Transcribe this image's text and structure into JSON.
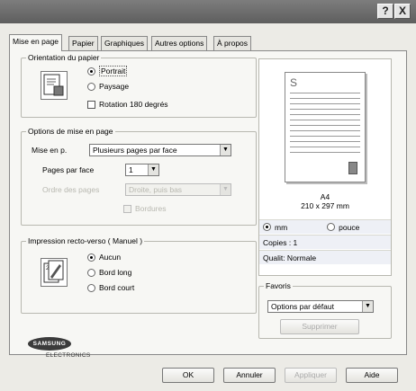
{
  "titlebar": {
    "help_label": "?",
    "close_label": "X"
  },
  "tabs": [
    {
      "label": "Mise en page",
      "active": true
    },
    {
      "label": "Papier",
      "active": false
    },
    {
      "label": "Graphiques",
      "active": false
    },
    {
      "label": "Autres options",
      "active": false
    },
    {
      "label": "À propos",
      "active": false
    }
  ],
  "orientation": {
    "title": "Orientation du papier",
    "portrait_label": "Portrait",
    "landscape_label": "Paysage",
    "rotate_label": "Rotation 180 degrés",
    "selected": "portrait",
    "rotate_checked": false
  },
  "layout_options": {
    "title": "Options de mise en page",
    "layout_label": "Mise en p.",
    "layout_value": "Plusieurs pages par face",
    "pages_per_side_label": "Pages par face",
    "pages_per_side_value": "1",
    "page_order_label": "Ordre des pages",
    "page_order_value": "Droite, puis bas",
    "borders_label": "Bordures"
  },
  "duplex": {
    "title": "Impression recto-verso ( Manuel )",
    "none_label": "Aucun",
    "long_edge_label": "Bord long",
    "short_edge_label": "Bord court",
    "selected": "none"
  },
  "preview": {
    "page_letter": "S",
    "paper_size": "A4",
    "paper_dims": "210 x 297 mm",
    "unit_mm_label": "mm",
    "unit_inch_label": "pouce",
    "selected_unit": "mm",
    "copies_text": "Copies : 1",
    "quality_text": "Qualit: Normale"
  },
  "favorites": {
    "title": "Favoris",
    "value": "Options par défaut",
    "delete_label": "Supprimer"
  },
  "logo": {
    "brand": "SAMSUNG",
    "sub": "ELECTRONICS"
  },
  "buttons": {
    "ok": "OK",
    "cancel": "Annuler",
    "apply": "Appliquer",
    "help": "Aide"
  }
}
